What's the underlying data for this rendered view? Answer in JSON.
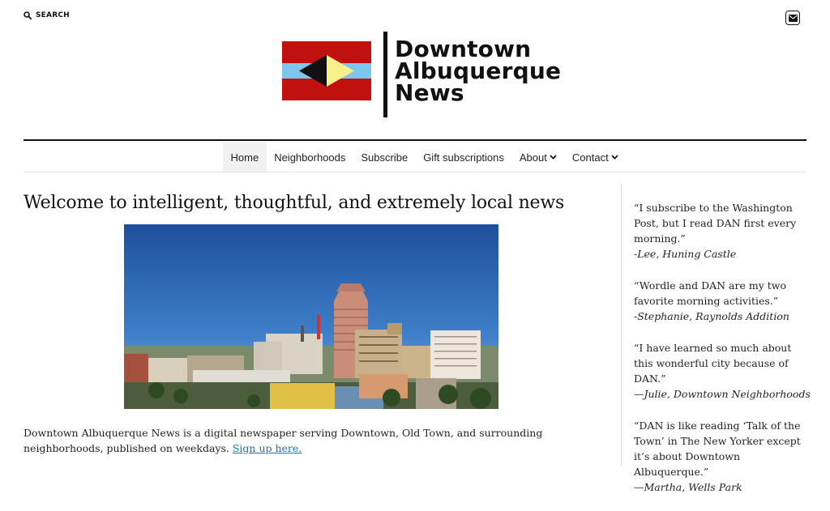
{
  "header": {
    "search_label": "SEARCH",
    "logo_lines": [
      "Downtown",
      "Albuquerque",
      "News"
    ],
    "flag_colors": {
      "red": "#c0110f",
      "blue": "#7cc7ee",
      "yellow": "#f6ef8a",
      "black": "#111111"
    }
  },
  "nav": {
    "items": [
      {
        "label": "Home",
        "dropdown": false
      },
      {
        "label": "Neighborhoods",
        "dropdown": false
      },
      {
        "label": "Subscribe",
        "dropdown": false
      },
      {
        "label": "Gift subscriptions",
        "dropdown": false
      },
      {
        "label": "About",
        "dropdown": true
      },
      {
        "label": "Contact",
        "dropdown": true
      }
    ],
    "active": "Home"
  },
  "main": {
    "headline": "Welcome to intelligent, thoughtful, and extremely local news",
    "intro_text": "Downtown Albuquerque News is a digital newspaper serving Downtown, Old Town, and surrounding neighborhoods, published on weekdays. ",
    "intro_link": "Sign up here."
  },
  "sidebar": {
    "quotes": [
      {
        "text": "“I subscribe to the Washington Post, but I read DAN first every morning.”",
        "attribution": "-Lee, Huning Castle"
      },
      {
        "text": "“Wordle and DAN are my two favorite morning activities.”",
        "attribution": "-Stephanie, Raynolds Addition"
      },
      {
        "text": "“I have learned so much about this wonderful city because of DAN.”",
        "attribution": "—Julie, Downtown Neighborhoods"
      },
      {
        "text": "“DAN is like reading ‘Talk of the Town’ in The New Yorker except it’s about Downtown Albuquerque.”",
        "attribution": "—Martha, Wells Park"
      }
    ]
  },
  "icons": {
    "search": "search-icon",
    "mail": "mail-icon",
    "chevron": "chevron-down-icon"
  }
}
